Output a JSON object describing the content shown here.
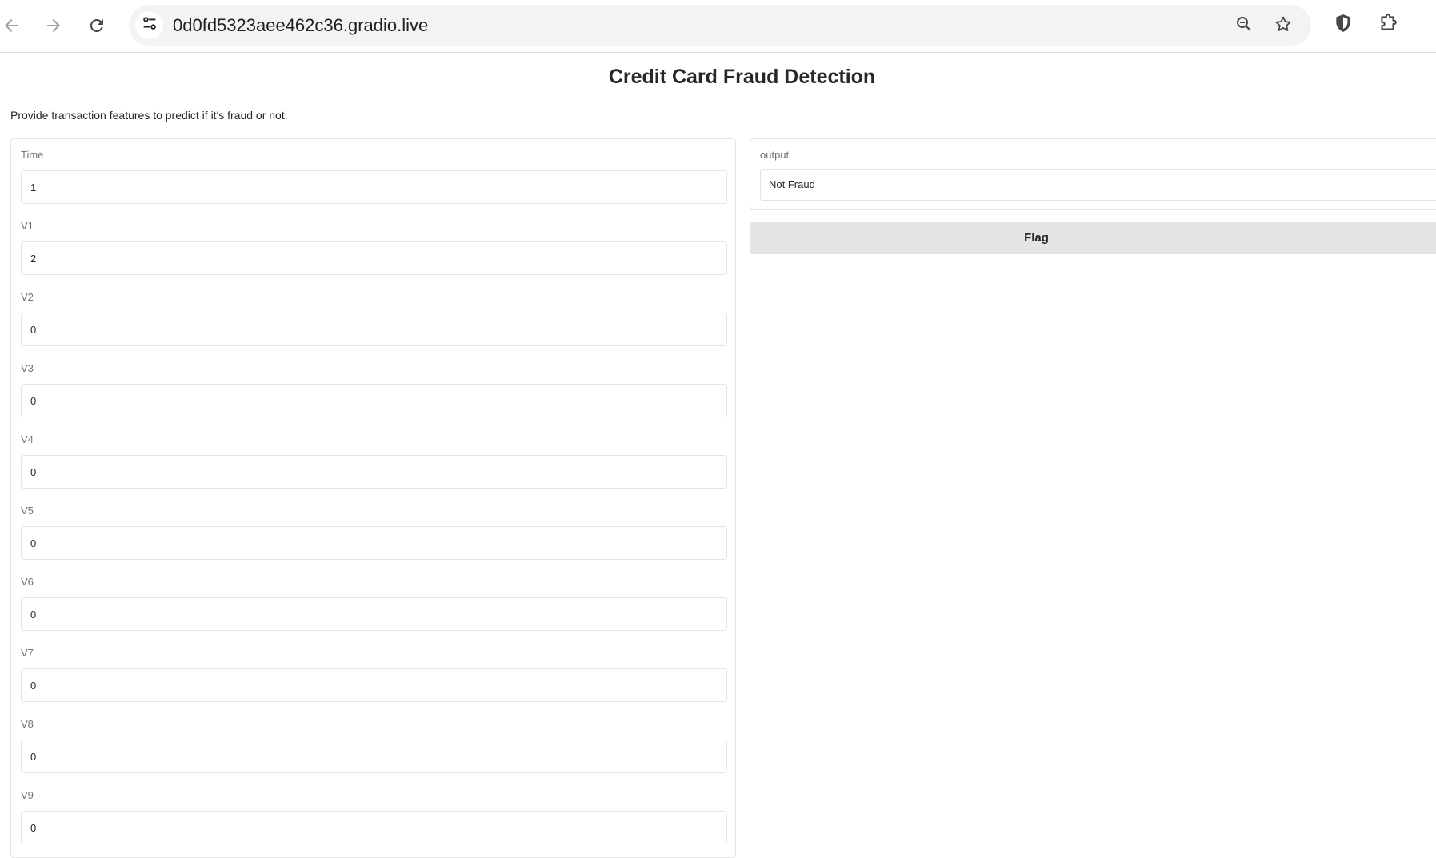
{
  "browser": {
    "url": "0d0fd5323aee462c36.gradio.live",
    "icons": {
      "back": "arrow-left-icon",
      "forward": "arrow-right-icon",
      "reload": "reload-icon",
      "site_info": "tune-icon",
      "zoom": "zoom-out-icon",
      "bookmark": "star-icon",
      "extension_shield": "shield-icon",
      "extensions": "puzzle-icon"
    }
  },
  "app": {
    "title": "Credit Card Fraud Detection",
    "description": "Provide transaction features to predict if it's fraud or not."
  },
  "inputs": [
    {
      "label": "Time",
      "value": "1"
    },
    {
      "label": "V1",
      "value": "2"
    },
    {
      "label": "V2",
      "value": "0"
    },
    {
      "label": "V3",
      "value": "0"
    },
    {
      "label": "V4",
      "value": "0"
    },
    {
      "label": "V5",
      "value": "0"
    },
    {
      "label": "V6",
      "value": "0"
    },
    {
      "label": "V7",
      "value": "0"
    },
    {
      "label": "V8",
      "value": "0"
    },
    {
      "label": "V9",
      "value": "0"
    }
  ],
  "output": {
    "label": "output",
    "value": "Not Fraud"
  },
  "flag_button": {
    "label": "Flag"
  },
  "colors": {
    "panel_border": "#e4e4e7",
    "button_bg": "#e4e4e7",
    "label": "#71717a",
    "text": "#27272a"
  }
}
